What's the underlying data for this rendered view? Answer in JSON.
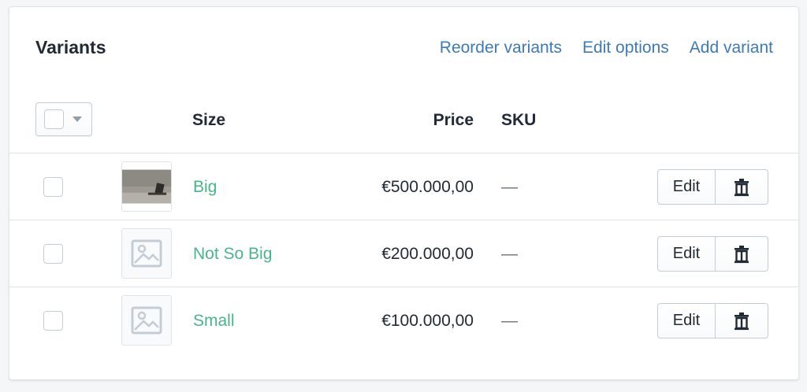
{
  "card": {
    "title": "Variants",
    "actions": [
      {
        "label": "Reorder variants"
      },
      {
        "label": "Edit options"
      },
      {
        "label": "Add variant"
      }
    ]
  },
  "table": {
    "columns": {
      "size": "Size",
      "price": "Price",
      "sku": "SKU"
    },
    "rows": [
      {
        "name": "Big",
        "price": "€500.000,00",
        "sku": "—",
        "image": "photo",
        "edit_label": "Edit",
        "delete_icon": "trash-icon"
      },
      {
        "name": "Not So Big",
        "price": "€200.000,00",
        "sku": "—",
        "image": "placeholder",
        "edit_label": "Edit",
        "delete_icon": "trash-icon"
      },
      {
        "name": "Small",
        "price": "€100.000,00",
        "sku": "—",
        "image": "placeholder",
        "edit_label": "Edit",
        "delete_icon": "trash-icon"
      }
    ]
  },
  "colors": {
    "link": "#3d7ab8",
    "variant_link": "#47b58a",
    "border": "#dfe3e8"
  }
}
